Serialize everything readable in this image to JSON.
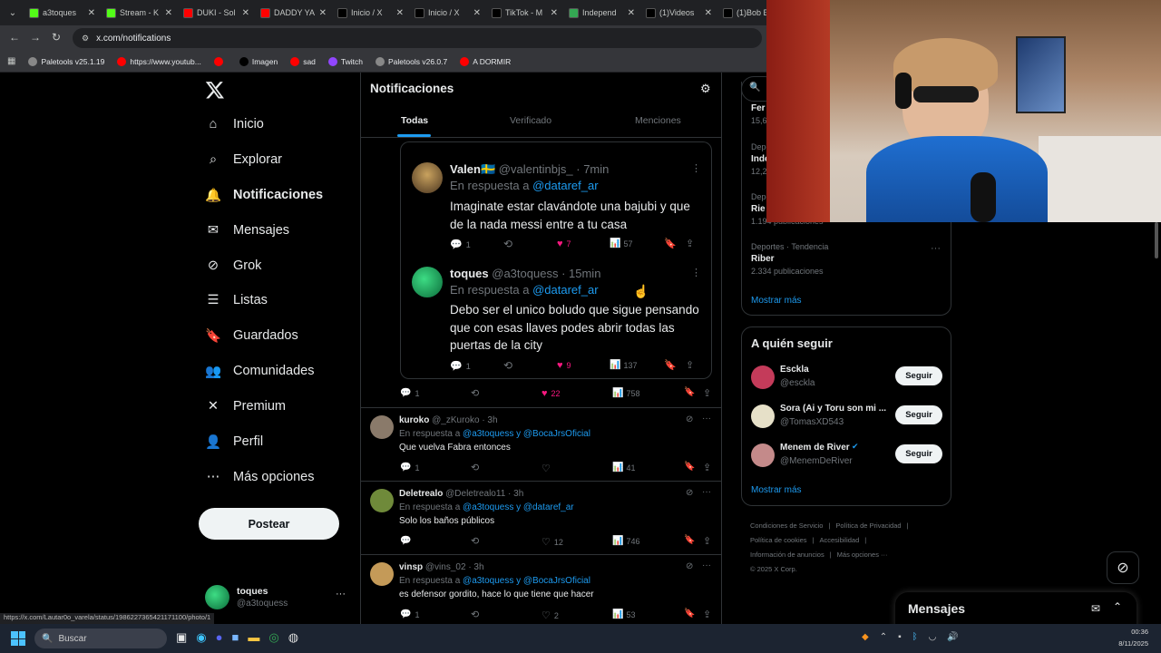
{
  "browser": {
    "tabs": [
      {
        "title": "a3toques",
        "color": "#53fc18"
      },
      {
        "title": "Stream - K",
        "color": "#53fc18"
      },
      {
        "title": "DUKI - Sol",
        "color": "#ff0000"
      },
      {
        "title": "DADDY YA",
        "color": "#ff0000"
      },
      {
        "title": "Inicio / X",
        "color": "#000000"
      },
      {
        "title": "Inicio / X",
        "color": "#000000"
      },
      {
        "title": "TikTok - M",
        "color": "#000000"
      },
      {
        "title": "Independ",
        "color": "#34a853"
      },
      {
        "title": "(1)Videos",
        "color": "#000000"
      },
      {
        "title": "(1)Bob E",
        "color": "#000000"
      }
    ],
    "url": "x.com/notifications",
    "bookmarks": [
      "Paletools v25.1.19",
      "https://www.youtub...",
      "",
      "Imagen",
      "sad",
      "Twitch",
      "Paletools v26.0.7",
      "A DORMIR"
    ]
  },
  "nav": {
    "items": [
      "Inicio",
      "Explorar",
      "Notificaciones",
      "Mensajes",
      "Grok",
      "Listas",
      "Guardados",
      "Comunidades",
      "Premium",
      "Perfil",
      "Más opciones"
    ],
    "post_label": "Postear",
    "account_name": "toques",
    "account_handle": "@a3toquess"
  },
  "notifications": {
    "title": "Notificaciones",
    "tabs": [
      "Todas",
      "Verificado",
      "Menciones"
    ],
    "thread": [
      {
        "name": "Valen🇸🇪",
        "handle": "@valentinbjs_",
        "time": "· 7min",
        "reply_to_prefix": "En respuesta a",
        "reply_to": "@dataref_ar",
        "text": "Imaginate estar clavándote una bajubi y que de la nada messi entre a tu casa",
        "replies": "1",
        "likes": "7",
        "views": "57"
      },
      {
        "name": "toques",
        "handle": "@a3toquess",
        "time": "· 15min",
        "reply_to_prefix": "En respuesta a",
        "reply_to": "@dataref_ar",
        "text": "Debo ser el unico boludo que sigue pensando que con esas llaves podes abrir todas las puertas de la city",
        "replies": "1",
        "likes": "9",
        "views": "137"
      }
    ],
    "thread_stats": {
      "replies": "1",
      "likes": "22",
      "views": "758"
    },
    "replies": [
      {
        "name": "kuroko",
        "handle": "@_zKuroko",
        "time": "· 3h",
        "prefix": "En respuesta a",
        "to": "@a3toquess y @BocaJrsOficial",
        "text": "Que vuelva Fabra entonces",
        "replies": "1",
        "likes": "",
        "views": "41"
      },
      {
        "name": "Deletrealo",
        "handle": "@Deletrealo11",
        "time": "· 3h",
        "prefix": "En respuesta a",
        "to": "@a3toquess y @dataref_ar",
        "text": "Solo los baños públicos",
        "replies": "",
        "likes": "12",
        "views": "746"
      },
      {
        "name": "vinsp",
        "handle": "@vins_02",
        "time": "· 3h",
        "prefix": "En respuesta a",
        "to": "@a3toquess y @BocaJrsOficial",
        "text": "es defensor gordito, hace lo que tiene que hacer",
        "replies": "1",
        "likes": "2",
        "views": "53"
      }
    ]
  },
  "trends": {
    "items": [
      {
        "name": "Fer",
        "count": "15,6"
      },
      {
        "category": "Depo",
        "name": "Inde",
        "count": "12,2"
      },
      {
        "category": "Depo",
        "name": "Rie",
        "count": "1.194 publicaciones"
      },
      {
        "category": "Deportes · Tendencia",
        "name": "Riber",
        "count": "2.334 publicaciones"
      }
    ],
    "show_more": "Mostrar más"
  },
  "who_to_follow": {
    "title": "A quién seguir",
    "accounts": [
      {
        "name": "Esckla",
        "handle": "@esckla"
      },
      {
        "name": "Sora (Ai y Toru son mi ...",
        "handle": "@TomasXD543"
      },
      {
        "name": "Menem de River",
        "handle": "@MenemDeRiver"
      }
    ],
    "follow_label": "Seguir",
    "show_more": "Mostrar más"
  },
  "footer_links": [
    "Condiciones de Servicio",
    "|",
    "Política de Privacidad",
    "|",
    "Política de cookies",
    "|",
    "Accesibilidad",
    "|",
    "Información de anuncios",
    "|",
    "Más opciones ···",
    "© 2025 X Corp."
  ],
  "messages_drawer": "Mensajes",
  "status_url": "https://x.com/Lautar0o_varela/status/1986227365421171100/photo/1",
  "taskbar": {
    "search": "Buscar",
    "time": "00:36",
    "date": "8/11/2025"
  }
}
